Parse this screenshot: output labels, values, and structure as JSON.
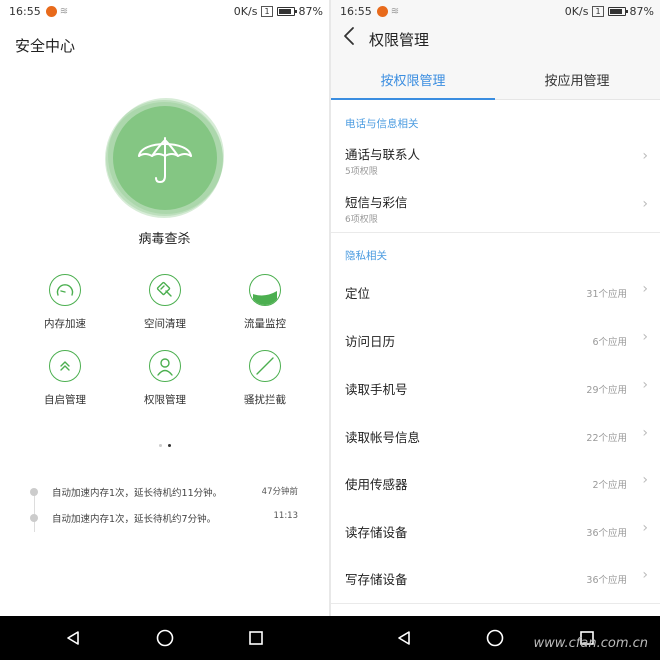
{
  "left": {
    "status": {
      "time": "16:55",
      "speed": "0K/s",
      "sim": "1",
      "battery": "87%"
    },
    "title": "安全中心",
    "virus_label": "病毒查杀",
    "grid": [
      {
        "label": "内存加速",
        "icon": "speedometer-icon"
      },
      {
        "label": "空间清理",
        "icon": "broom-icon"
      },
      {
        "label": "流量监控",
        "icon": "data-usage-icon"
      },
      {
        "label": "自启管理",
        "icon": "double-chevron-up-icon"
      },
      {
        "label": "权限管理",
        "icon": "person-icon"
      },
      {
        "label": "骚扰拦截",
        "icon": "block-icon"
      }
    ],
    "timeline": [
      {
        "text": "自动加速内存1次，延长待机约11分钟。",
        "time": "47分钟前"
      },
      {
        "text": "自动加速内存1次，延长待机约7分钟。",
        "time": "11:13"
      }
    ]
  },
  "right": {
    "status": {
      "time": "16:55",
      "speed": "0K/s",
      "sim": "1",
      "battery": "87%"
    },
    "title": "权限管理",
    "tabs": {
      "by_permission": "按权限管理",
      "by_app": "按应用管理"
    },
    "section1": "电话与信息相关",
    "phone_items": [
      {
        "name": "通话与联系人",
        "sub": "5项权限"
      },
      {
        "name": "短信与彩信",
        "sub": "6项权限"
      }
    ],
    "section2": "隐私相关",
    "privacy_items": [
      {
        "name": "定位",
        "count": "31个应用"
      },
      {
        "name": "访问日历",
        "count": "6个应用"
      },
      {
        "name": "读取手机号",
        "count": "29个应用"
      },
      {
        "name": "读取帐号信息",
        "count": "22个应用"
      },
      {
        "name": "使用传感器",
        "count": "2个应用"
      },
      {
        "name": "读存储设备",
        "count": "36个应用"
      },
      {
        "name": "写存储设备",
        "count": "36个应用"
      }
    ]
  },
  "watermark": "www.cfan.com.cn",
  "colors": {
    "accent_green": "#84c683",
    "icon_green": "#4caf50",
    "accent_blue": "#3a8de0"
  }
}
